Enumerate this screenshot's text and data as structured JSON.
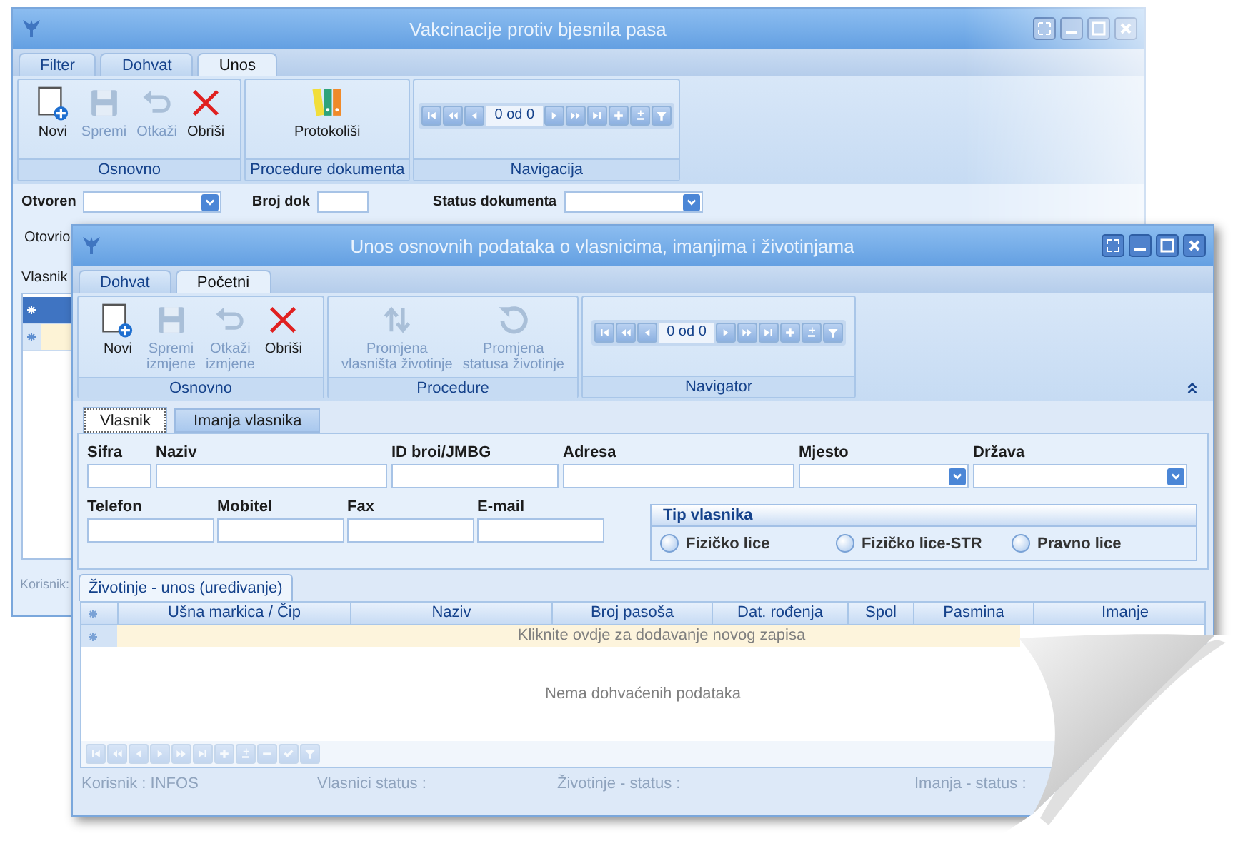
{
  "back_window": {
    "title": "Vakcinacije protiv bjesnila pasa",
    "tabs": [
      {
        "label": "Filter",
        "selected": false
      },
      {
        "label": "Dohvat",
        "selected": false
      },
      {
        "label": "Unos",
        "selected": true
      }
    ],
    "ribbon_groups": [
      {
        "label": "Osnovno",
        "kind": "buttons",
        "buttons": [
          {
            "label": "Novi",
            "kind": "new",
            "disabled": false
          },
          {
            "label": "Spremi",
            "kind": "save",
            "disabled": true
          },
          {
            "label": "Otkaži",
            "kind": "undo",
            "disabled": true
          },
          {
            "label": "Obriši",
            "kind": "delete",
            "disabled": false
          }
        ]
      },
      {
        "label": "Procedure dokumenta",
        "kind": "buttons",
        "buttons": [
          {
            "label": "Protokoliši",
            "kind": "binders",
            "disabled": false
          }
        ]
      },
      {
        "label": "Navigacija",
        "kind": "navigator",
        "navigator": {
          "before": [
            {
              "kind": "first"
            },
            {
              "kind": "prevpage"
            },
            {
              "kind": "prev"
            }
          ],
          "counter": "0 od 0",
          "after": [
            {
              "kind": "next"
            },
            {
              "kind": "nextpage"
            },
            {
              "kind": "last"
            },
            {
              "kind": "add"
            },
            {
              "kind": "append"
            },
            {
              "kind": "filter"
            }
          ]
        }
      }
    ],
    "filter_fields": [
      {
        "label": "Otvoren",
        "kind": "combo"
      },
      {
        "label": "Broj dok",
        "kind": "text"
      },
      {
        "label": "Status dokumenta",
        "kind": "combo"
      }
    ],
    "labels": [
      "Otovrio",
      "Vlasnik"
    ],
    "status": "Korisnik:"
  },
  "front_window": {
    "title": "Unos osnovnih podataka o vlasnicima, imanjima i životinjama",
    "tabs": [
      {
        "label": "Dohvat",
        "selected": false
      },
      {
        "label": "Početni",
        "selected": true
      }
    ],
    "ribbon_groups": [
      {
        "label": "Osnovno",
        "kind": "buttons",
        "buttons": [
          {
            "label": "Novi",
            "kind": "new",
            "disabled": false
          },
          {
            "label": "Spremi\nizmjene",
            "kind": "save",
            "disabled": true
          },
          {
            "label": "Otkaži\nizmjene",
            "kind": "undo",
            "disabled": true
          },
          {
            "label": "Obriši",
            "kind": "delete",
            "disabled": false
          }
        ]
      },
      {
        "label": "Procedure",
        "kind": "buttons",
        "buttons": [
          {
            "label": "Promjena\nvlasništa životinje",
            "kind": "swap",
            "disabled": true
          },
          {
            "label": "Promjena\nstatusa životinje",
            "kind": "refresh",
            "disabled": true
          }
        ]
      },
      {
        "label": "Navigator",
        "kind": "navigator",
        "navigator": {
          "before": [
            {
              "kind": "first"
            },
            {
              "kind": "prevpage"
            },
            {
              "kind": "prev"
            }
          ],
          "counter": "0 od 0",
          "after": [
            {
              "kind": "next"
            },
            {
              "kind": "nextpage"
            },
            {
              "kind": "last"
            },
            {
              "kind": "add"
            },
            {
              "kind": "append"
            },
            {
              "kind": "filter"
            }
          ]
        }
      }
    ],
    "sub_tabs": [
      {
        "label": "Vlasnik",
        "selected": true
      },
      {
        "label": "Imanja vlasnika",
        "selected": false
      }
    ],
    "form_rows": [
      [
        {
          "label": "Sifra",
          "kind": "text"
        },
        {
          "label": "Naziv",
          "kind": "text"
        },
        {
          "label": "ID broi/JMBG",
          "kind": "text"
        },
        {
          "label": "Adresa",
          "kind": "text"
        },
        {
          "label": "Mjesto",
          "kind": "combo"
        },
        {
          "label": "Država",
          "kind": "combo"
        }
      ],
      [
        {
          "label": "Telefon",
          "kind": "text"
        },
        {
          "label": "Mobitel",
          "kind": "text"
        },
        {
          "label": "Fax",
          "kind": "text"
        },
        {
          "label": "E-mail",
          "kind": "text"
        }
      ]
    ],
    "owner_type": {
      "title": "Tip vlasnika",
      "options": [
        {
          "label": "Fizičko lice",
          "selected": false
        },
        {
          "label": "Fizičko lice-STR",
          "selected": false
        },
        {
          "label": "Pravno lice",
          "selected": false
        }
      ]
    },
    "animals_tab": {
      "label": "Životinje - unos (uređivanje)",
      "selected": true
    },
    "grid": {
      "columns": [
        "Ušna markica / Čip",
        "Naziv",
        "Broj pasoša",
        "Dat. rođenja",
        "Spol",
        "Pasmina",
        "Imanje"
      ],
      "new_row_text": "Kliknite ovdje za dodavanje novog zapisa",
      "empty_text": "Nema dohvaćenih podataka",
      "navigator": [
        {
          "kind": "first"
        },
        {
          "kind": "prevpage"
        },
        {
          "kind": "prev"
        },
        {
          "kind": "next"
        },
        {
          "kind": "nextpage"
        },
        {
          "kind": "last"
        },
        {
          "kind": "add"
        },
        {
          "kind": "append"
        },
        {
          "kind": "remove"
        },
        {
          "kind": "edit"
        },
        {
          "kind": "filter"
        }
      ]
    },
    "status_bar": [
      "Korisnik : INFOS",
      "Vlasnici status :",
      "Životinje - status :",
      "Imanja - status :"
    ]
  }
}
